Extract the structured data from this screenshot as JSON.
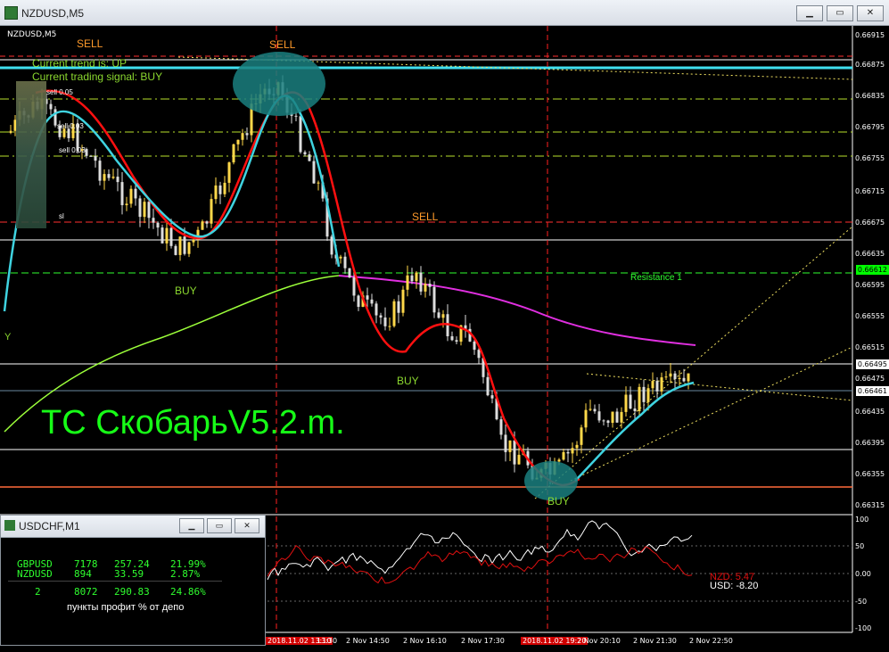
{
  "window": {
    "title": "NZDUSD,M5",
    "buttons": [
      "▁",
      "▭",
      "✕"
    ]
  },
  "chart": {
    "symbol_label": "NZDUSD,M5",
    "price_labels": [
      "0.66915",
      "0.66875",
      "0.66835",
      "0.66795",
      "0.66755",
      "0.66715",
      "0.66675",
      "0.66635",
      "0.66595",
      "0.66555",
      "0.66515",
      "0.66475",
      "0.66435",
      "0.66395",
      "0.66355",
      "0.66315"
    ],
    "price_boxes": [
      {
        "value": "0.66612",
        "color": "#00ff00"
      },
      {
        "value": "0.66495",
        "color": "#ffffff"
      },
      {
        "value": "0.66461",
        "color": "#ffffff"
      }
    ],
    "overlay": {
      "trend_line": "Current trend is: UP",
      "signal_line": "Current trading signal: BUY",
      "orders": [
        "sell 0.05",
        "sell 0.03",
        "sell 0.03",
        "sl"
      ],
      "edge_letter": "Y"
    },
    "signals": {
      "sell_top_left": "SELL",
      "sell_top_circle": "SELL",
      "sell_mid": "SELL",
      "buy_left": "BUY",
      "buy_mid": "BUY",
      "buy_bottom": "BUY"
    },
    "resistance_label": "Resistance 1",
    "watermark": "ТС СкобарьV5.2.m.",
    "indicator": {
      "levels": [
        "100",
        "50",
        "0.00",
        "-50",
        "-100"
      ],
      "nzd_label": "NZD: 5.47",
      "usd_label": "USD: -8.20"
    },
    "time_labels": [
      "2018.11.02 13:10",
      "13:30",
      "2 Nov 14:50",
      "2 Nov 16:10",
      "2 Nov 17:30",
      "2018.11.02 19:20",
      "2 Nov 20:10",
      "2 Nov 21:30",
      "2 Nov 22:50"
    ]
  },
  "sub_window": {
    "title": "USDCHF,M1",
    "buttons": [
      "▁",
      "▭",
      "✕"
    ],
    "rows": [
      {
        "symbol": "GBPUSD",
        "points": "7178",
        "profit": "257.24",
        "percent": "21.99%"
      },
      {
        "symbol": "NZDUSD",
        "points": "894",
        "profit": "33.59",
        "percent": "2.87%"
      }
    ],
    "total": {
      "count": "2",
      "points": "8072",
      "profit": "290.83",
      "percent": "24.86%"
    },
    "footer": "пункты  профит  % от депо"
  },
  "colors": {
    "up_candle": "#ffd84a",
    "down_candle": "#dddddd",
    "red_ma": "#ff1010",
    "cyan_ma": "#3fd3e0",
    "magenta_ma": "#e02fe0",
    "green_ma": "#9cff3a"
  }
}
